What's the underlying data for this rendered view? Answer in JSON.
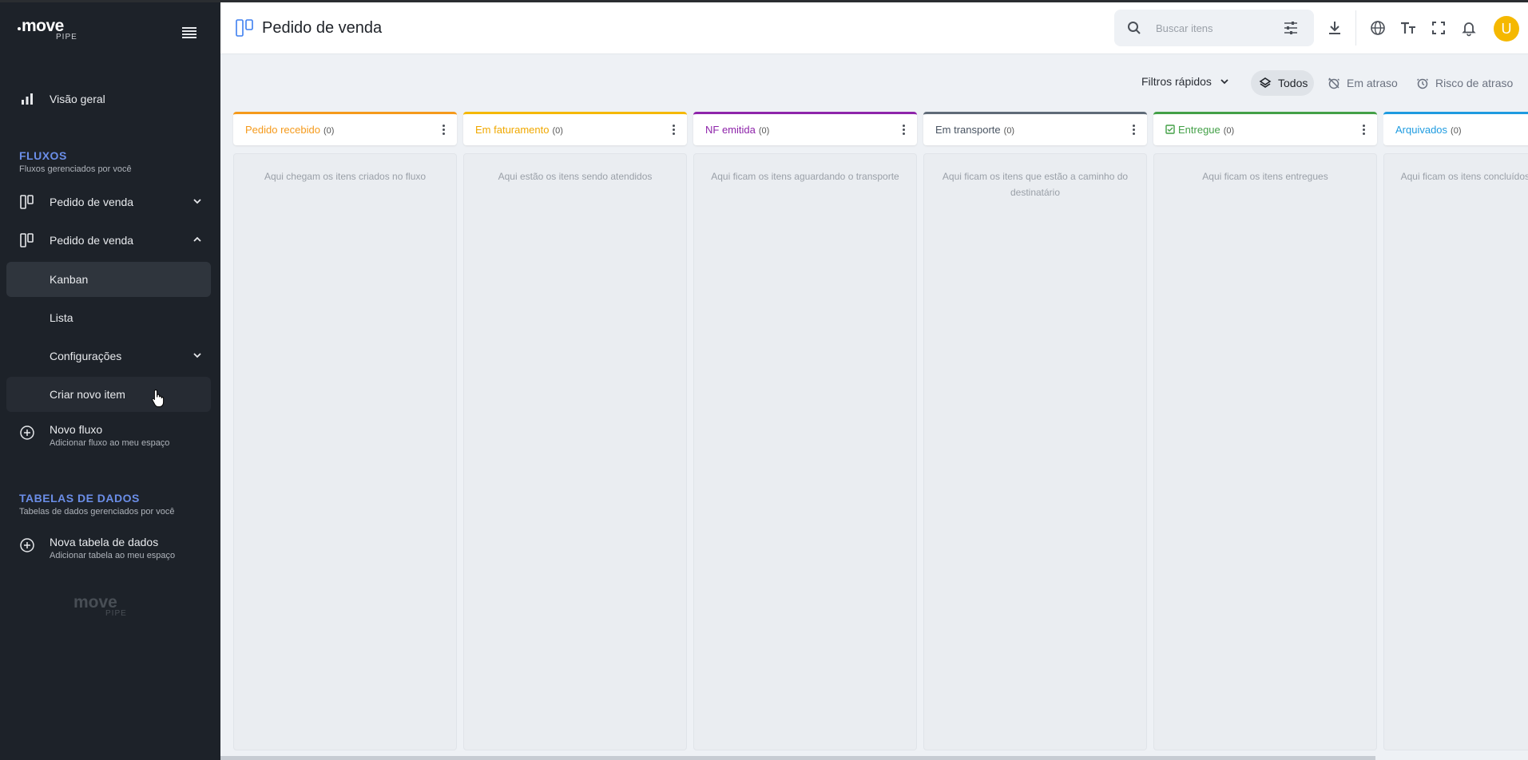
{
  "app": {
    "logo_main": "move",
    "logo_sub": "PIPE"
  },
  "sidebar": {
    "overview": {
      "label": "Visão geral"
    },
    "flows_section": {
      "title": "FLUXOS",
      "subtitle": "Fluxos gerenciados por você"
    },
    "flow_items": [
      {
        "label": "Pedido de venda"
      },
      {
        "label": "Pedido de venda"
      }
    ],
    "sub_items": {
      "kanban": "Kanban",
      "lista": "Lista",
      "configuracoes": "Configurações",
      "criar": "Criar novo item"
    },
    "new_flow": {
      "label": "Novo fluxo",
      "sub": "Adicionar fluxo ao meu espaço"
    },
    "tables_section": {
      "title": "TABELAS DE DADOS",
      "subtitle": "Tabelas de dados gerenciados por você"
    },
    "new_table": {
      "label": "Nova tabela de dados",
      "sub": "Adicionar tabela ao meu espaço"
    }
  },
  "header": {
    "title": "Pedido de venda",
    "search_placeholder": "Buscar itens",
    "avatar_initial": "U"
  },
  "filters": {
    "quick_label": "Filtros rápidos",
    "options": [
      {
        "label": "Todos",
        "selected": true
      },
      {
        "label": "Em atraso",
        "selected": false
      },
      {
        "label": "Risco de atraso",
        "selected": false
      }
    ]
  },
  "kanban": {
    "columns": [
      {
        "name": "Pedido recebido",
        "count": "(0)",
        "color": "#f59a1b",
        "empty": "Aqui chegam os itens criados no fluxo"
      },
      {
        "name": "Em faturamento",
        "count": "(0)",
        "color": "#f5b800",
        "empty": "Aqui estão os itens sendo atendidos"
      },
      {
        "name": "NF emitida",
        "count": "(0)",
        "color": "#8e24aa",
        "empty": "Aqui ficam os itens aguardando o transporte"
      },
      {
        "name": "Em transporte",
        "count": "(0)",
        "color": "#5f6b78",
        "empty": "Aqui ficam os itens que estão a caminho do destinatário"
      },
      {
        "name": "Entregue",
        "count": "(0)",
        "color": "#43a047",
        "empty": "Aqui ficam os itens entregues"
      },
      {
        "name": "Arquivados",
        "count": "(0)",
        "color": "#1e9be0",
        "empty": "Aqui ficam os itens concluídos e destinatário"
      }
    ]
  }
}
